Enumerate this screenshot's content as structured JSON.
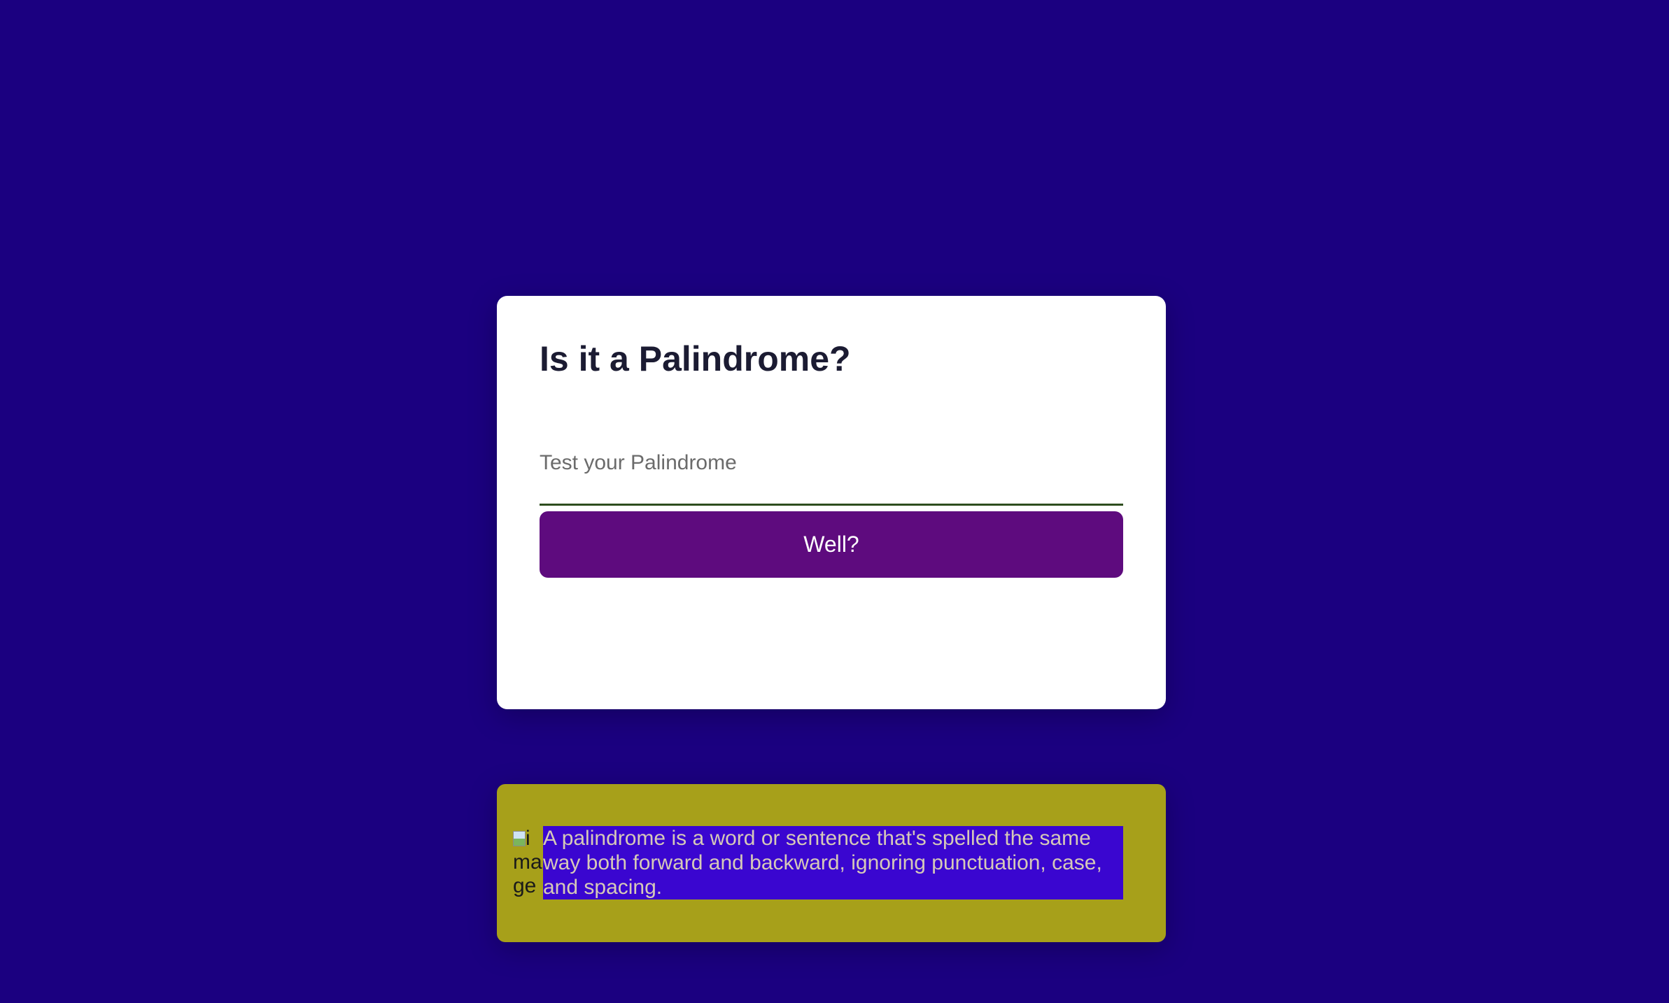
{
  "app": {
    "title": "Is it a Palindrome?"
  },
  "form": {
    "input_placeholder": "Test your Palindrome",
    "input_value": "",
    "button_label": "Well?"
  },
  "info": {
    "icon_alt": "image icon",
    "icon_name": "broken-image-icon",
    "text": "A palindrome is a word or sentence that's spelled the same way both forward and backward, ignoring punctuation, case, and spacing."
  },
  "colors": {
    "background": "#1b0080",
    "card": "#ffffff",
    "button": "#5e0b7e",
    "info_box": "#a7a01a",
    "info_text_bg": "#3a06d0",
    "input_underline": "#2e4d1e"
  }
}
